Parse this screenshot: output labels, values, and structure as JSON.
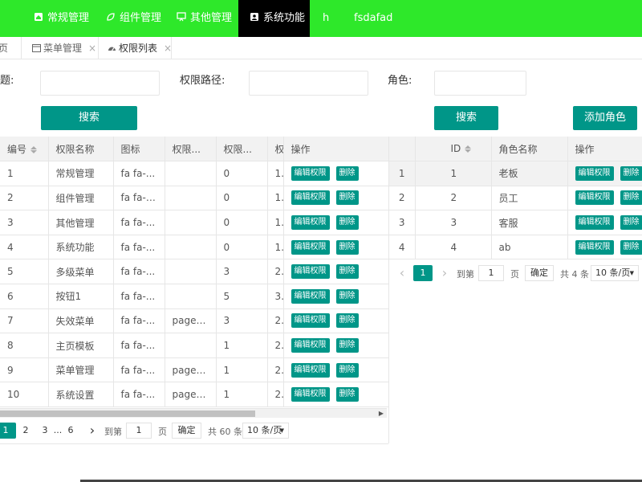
{
  "topnav": {
    "bg": "#2ee82a",
    "items": [
      {
        "label": "常规管理",
        "icon": "home-icon"
      },
      {
        "label": "组件管理",
        "icon": "leaf-icon"
      },
      {
        "label": "其他管理",
        "icon": "slideshow-icon"
      },
      {
        "label": "系统功能",
        "icon": "user-icon",
        "active": true
      },
      {
        "label": "h"
      },
      {
        "label": "fsdafad"
      }
    ]
  },
  "tabs": [
    {
      "label": "页"
    },
    {
      "label": "菜单管理",
      "icon": "window-icon",
      "close": "×"
    },
    {
      "label": "权限列表",
      "icon": "dashboard-icon",
      "close": "×",
      "active": true
    }
  ],
  "left_search": {
    "title_label": "题:",
    "path_label": "权限路径:",
    "title_value": "",
    "path_value": "",
    "button": "搜索"
  },
  "right_search": {
    "role_label": "角色:",
    "role_value": "",
    "button": "搜索",
    "add_button": "添加角色"
  },
  "perm_table": {
    "columns": [
      "编号",
      "权限名称",
      "图标",
      "权限...",
      "权限...",
      "权",
      "操作"
    ],
    "rows": [
      {
        "id": "1",
        "name": "常规管理",
        "icon": "fa fa-...",
        "path": "",
        "parent": "0",
        "type": "1"
      },
      {
        "id": "2",
        "name": "组件管理",
        "icon": "fa fa-l...",
        "path": "",
        "parent": "0",
        "type": "1"
      },
      {
        "id": "3",
        "name": "其他管理",
        "icon": "fa fa-...",
        "path": "",
        "parent": "0",
        "type": "1"
      },
      {
        "id": "4",
        "name": "系统功能",
        "icon": "fa fa-...",
        "path": "",
        "parent": "0",
        "type": "1"
      },
      {
        "id": "5",
        "name": "多级菜单",
        "icon": "fa fa-...",
        "path": "",
        "parent": "3",
        "type": "2"
      },
      {
        "id": "6",
        "name": "按钮1",
        "icon": "fa fa-...",
        "path": "",
        "parent": "5",
        "type": "3"
      },
      {
        "id": "7",
        "name": "失效菜单",
        "icon": "fa fa-...",
        "path": "page/...",
        "parent": "3",
        "type": "2"
      },
      {
        "id": "8",
        "name": "主页模板",
        "icon": "fa fa-...",
        "path": "",
        "parent": "1",
        "type": "2"
      },
      {
        "id": "9",
        "name": "菜单管理",
        "icon": "fa fa-...",
        "path": "page/...",
        "parent": "1",
        "type": "2"
      },
      {
        "id": "10",
        "name": "系统设置",
        "icon": "fa fa-...",
        "path": "page/...",
        "parent": "1",
        "type": "2"
      }
    ],
    "action_edit": "编辑权限",
    "action_delete": "删除"
  },
  "perm_pager": {
    "pages": [
      "1",
      "2",
      "3",
      "...",
      "6"
    ],
    "next": "›",
    "goto_label": "到第",
    "goto_value": "1",
    "page_unit": "页",
    "confirm": "确定",
    "total": "共 60 条",
    "size": "10 条/页"
  },
  "role_table": {
    "columns": [
      "",
      "ID",
      "角色名称",
      "操作"
    ],
    "rows": [
      {
        "idx": "1",
        "id": "1",
        "name": "老板"
      },
      {
        "idx": "2",
        "id": "2",
        "name": "员工"
      },
      {
        "idx": "3",
        "id": "3",
        "name": "客服"
      },
      {
        "idx": "4",
        "id": "4",
        "name": "ab"
      }
    ],
    "action_edit": "编辑权限",
    "action_delete": "删除"
  },
  "role_pager": {
    "prev": "‹",
    "page": "1",
    "next": "›",
    "goto_label": "到第",
    "goto_value": "1",
    "page_unit": "页",
    "confirm": "确定",
    "total": "共 4 条",
    "size": "10 条/页"
  },
  "accent": "#009688"
}
